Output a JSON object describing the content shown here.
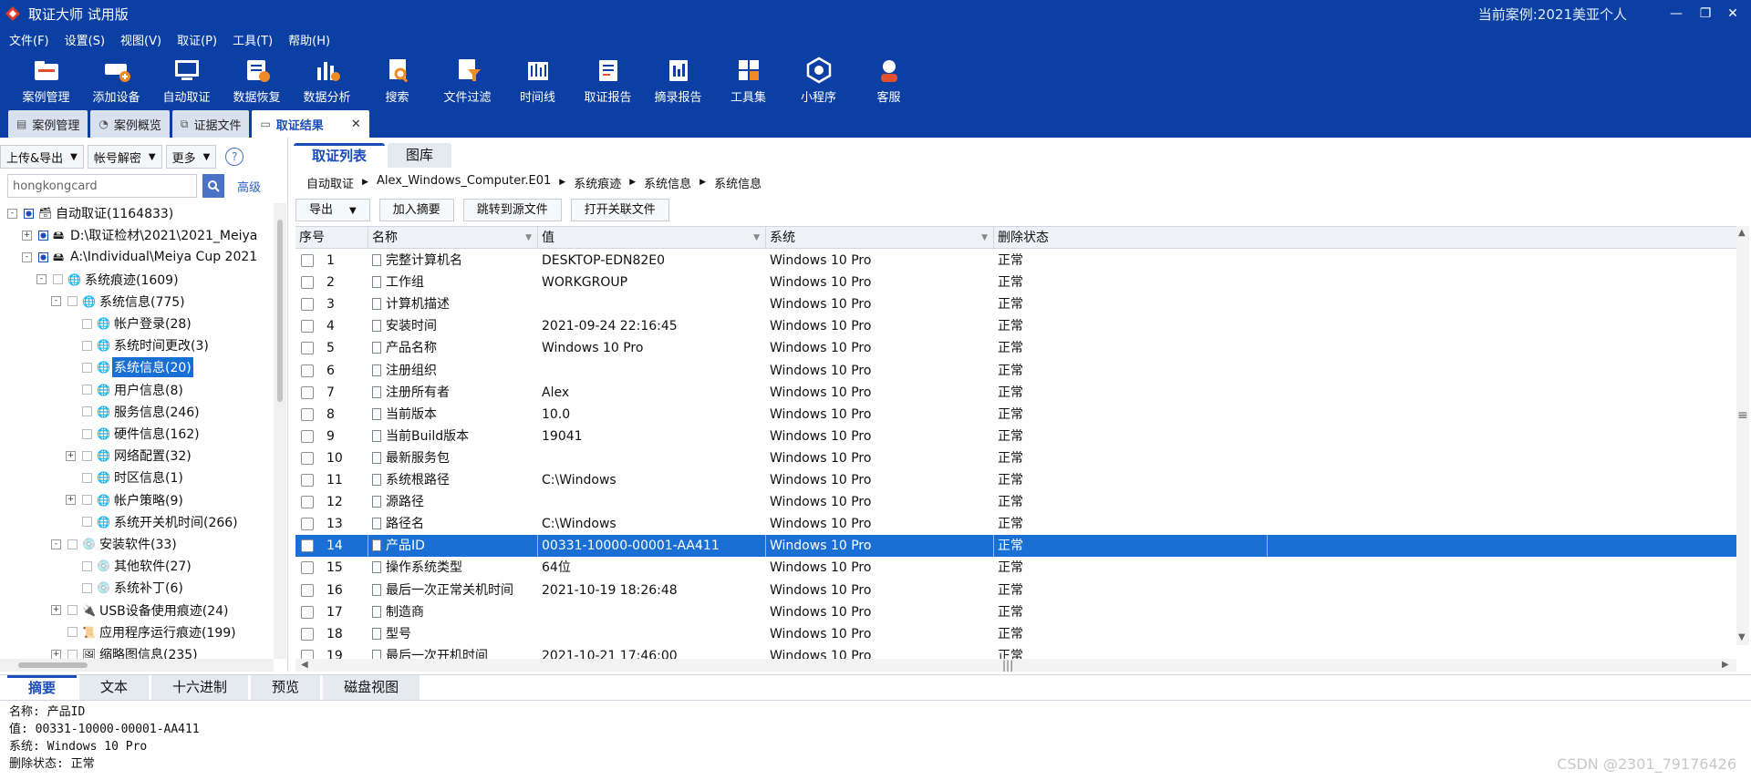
{
  "titlebar": {
    "app_title": "取证大师 试用版",
    "case_prefix": "当前案例:",
    "case_name": "2021美亚个人",
    "minimize": "—",
    "maximize": "❐",
    "close": "✕"
  },
  "menu": [
    "文件(F)",
    "设置(S)",
    "视图(V)",
    "取证(P)",
    "工具(T)",
    "帮助(H)"
  ],
  "toolbar": [
    {
      "label": "案例管理",
      "icon": "folder-icon"
    },
    {
      "label": "添加设备",
      "icon": "add-device-icon"
    },
    {
      "label": "自动取证",
      "icon": "auto-forensics-icon"
    },
    {
      "label": "数据恢复",
      "icon": "data-recovery-icon"
    },
    {
      "label": "数据分析",
      "icon": "data-analysis-icon"
    },
    {
      "label": "搜索",
      "icon": "search-icon"
    },
    {
      "label": "文件过滤",
      "icon": "file-filter-icon"
    },
    {
      "label": "时间线",
      "icon": "timeline-icon"
    },
    {
      "label": "取证报告",
      "icon": "report-icon"
    },
    {
      "label": "摘录报告",
      "icon": "excerpt-report-icon"
    },
    {
      "label": "工具集",
      "icon": "toolset-icon"
    },
    {
      "label": "小程序",
      "icon": "mini-program-icon"
    },
    {
      "label": "客服",
      "icon": "customer-service-icon"
    }
  ],
  "doc_tabs": [
    {
      "label": "案例管理",
      "icon": "case-tab-icon"
    },
    {
      "label": "案例概览",
      "icon": "overview-tab-icon"
    },
    {
      "label": "证据文件",
      "icon": "evidence-tab-icon"
    },
    {
      "label": "取证结果",
      "icon": "result-tab-icon",
      "active": true
    }
  ],
  "left": {
    "upload_export": "上传&导出",
    "account_decrypt": "帐号解密",
    "more": "更多",
    "help": "?",
    "search_value": "hongkongcard",
    "advanced": "高级",
    "tree": [
      {
        "label": "自动取证(1164833)",
        "level": 0,
        "exp": "-",
        "icon": "forensics-icon",
        "partial": true
      },
      {
        "label": "D:\\取证检材\\2021\\2021_Meiya",
        "level": 1,
        "exp": "+",
        "icon": "disk-icon",
        "partial": true
      },
      {
        "label": "A:\\Individual\\Meiya Cup 2021",
        "level": 1,
        "exp": "-",
        "icon": "disk-icon",
        "partial": true
      },
      {
        "label": "系统痕迹(1609)",
        "level": 2,
        "exp": "-",
        "icon": "globe-icon"
      },
      {
        "label": "系统信息(775)",
        "level": 3,
        "exp": "-",
        "icon": "globe-icon"
      },
      {
        "label": "帐户登录(28)",
        "level": 4,
        "exp": "",
        "icon": "globe-icon"
      },
      {
        "label": "系统时间更改(3)",
        "level": 4,
        "exp": "",
        "icon": "globe-icon"
      },
      {
        "label": "系统信息(20)",
        "level": 4,
        "exp": "",
        "icon": "globe-icon",
        "selected": true
      },
      {
        "label": "用户信息(8)",
        "level": 4,
        "exp": "",
        "icon": "globe-icon"
      },
      {
        "label": "服务信息(246)",
        "level": 4,
        "exp": "",
        "icon": "globe-icon"
      },
      {
        "label": "硬件信息(162)",
        "level": 4,
        "exp": "",
        "icon": "globe-icon"
      },
      {
        "label": "网络配置(32)",
        "level": 4,
        "exp": "+",
        "icon": "globe-icon"
      },
      {
        "label": "时区信息(1)",
        "level": 4,
        "exp": "",
        "icon": "globe-icon"
      },
      {
        "label": "帐户策略(9)",
        "level": 4,
        "exp": "+",
        "icon": "globe-icon"
      },
      {
        "label": "系统开关机时间(266)",
        "level": 4,
        "exp": "",
        "icon": "globe-icon"
      },
      {
        "label": "安装软件(33)",
        "level": 3,
        "exp": "-",
        "icon": "software-icon"
      },
      {
        "label": "其他软件(27)",
        "level": 4,
        "exp": "",
        "icon": "software-icon"
      },
      {
        "label": "系统补丁(6)",
        "level": 4,
        "exp": "",
        "icon": "software-icon"
      },
      {
        "label": "USB设备使用痕迹(24)",
        "level": 3,
        "exp": "+",
        "icon": "usb-icon"
      },
      {
        "label": "应用程序运行痕迹(199)",
        "level": 3,
        "exp": "",
        "icon": "app-run-icon"
      },
      {
        "label": "缩略图信息(235)",
        "level": 3,
        "exp": "+",
        "icon": "thumbnail-icon"
      }
    ]
  },
  "right": {
    "view_tabs": [
      "取证列表",
      "图库"
    ],
    "breadcrumb": [
      "自动取证",
      "Alex_Windows_Computer.E01",
      "系统痕迹",
      "系统信息",
      "系统信息"
    ],
    "actions": {
      "export": "导出",
      "add_excerpt": "加入摘要",
      "goto_source": "跳转到源文件",
      "open_related": "打开关联文件"
    },
    "columns": [
      "序号",
      "名称",
      "值",
      "系统",
      "删除状态"
    ],
    "rows": [
      {
        "no": "1",
        "name": "完整计算机名",
        "value": "DESKTOP-EDN82E0",
        "system": "Windows 10 Pro",
        "status": "正常"
      },
      {
        "no": "2",
        "name": "工作组",
        "value": "WORKGROUP",
        "system": "Windows 10 Pro",
        "status": "正常"
      },
      {
        "no": "3",
        "name": "计算机描述",
        "value": "",
        "system": "Windows 10 Pro",
        "status": "正常"
      },
      {
        "no": "4",
        "name": "安装时间",
        "value": "2021-09-24 22:16:45",
        "system": "Windows 10 Pro",
        "status": "正常"
      },
      {
        "no": "5",
        "name": "产品名称",
        "value": "Windows 10 Pro",
        "system": "Windows 10 Pro",
        "status": "正常"
      },
      {
        "no": "6",
        "name": "注册组织",
        "value": "",
        "system": "Windows 10 Pro",
        "status": "正常"
      },
      {
        "no": "7",
        "name": "注册所有者",
        "value": "Alex",
        "system": "Windows 10 Pro",
        "status": "正常"
      },
      {
        "no": "8",
        "name": "当前版本",
        "value": "10.0",
        "system": "Windows 10 Pro",
        "status": "正常"
      },
      {
        "no": "9",
        "name": "当前Build版本",
        "value": "19041",
        "system": "Windows 10 Pro",
        "status": "正常"
      },
      {
        "no": "10",
        "name": "最新服务包",
        "value": "",
        "system": "Windows 10 Pro",
        "status": "正常"
      },
      {
        "no": "11",
        "name": "系统根路径",
        "value": "C:\\Windows",
        "system": "Windows 10 Pro",
        "status": "正常"
      },
      {
        "no": "12",
        "name": "源路径",
        "value": "",
        "system": "Windows 10 Pro",
        "status": "正常"
      },
      {
        "no": "13",
        "name": "路径名",
        "value": "C:\\Windows",
        "system": "Windows 10 Pro",
        "status": "正常"
      },
      {
        "no": "14",
        "name": "产品ID",
        "value": "00331-10000-00001-AA411",
        "system": "Windows 10 Pro",
        "status": "正常",
        "selected": true
      },
      {
        "no": "15",
        "name": "操作系统类型",
        "value": "64位",
        "system": "Windows 10 Pro",
        "status": "正常"
      },
      {
        "no": "16",
        "name": "最后一次正常关机时间",
        "value": "2021-10-19 18:26:48",
        "system": "Windows 10 Pro",
        "status": "正常"
      },
      {
        "no": "17",
        "name": "制造商",
        "value": "",
        "system": "Windows 10 Pro",
        "status": "正常"
      },
      {
        "no": "18",
        "name": "型号",
        "value": "",
        "system": "Windows 10 Pro",
        "status": "正常"
      },
      {
        "no": "19",
        "name": "最后一次开机时间",
        "value": "2021-10-21 17:46:00",
        "system": "Windows 10 Pro",
        "status": "正常"
      }
    ]
  },
  "detail": {
    "tabs": [
      "摘要",
      "文本",
      "十六进制",
      "预览",
      "磁盘视图"
    ],
    "lines": [
      "名称: 产品ID",
      "值: 00331-10000-00001-AA411",
      "系统: Windows 10 Pro",
      "删除状态: 正常"
    ]
  },
  "watermark": "CSDN @2301_79176426",
  "colors": {
    "titlebar": "#0b3fa3",
    "selection": "#1a6fd4",
    "accent": "#1a4db8"
  }
}
